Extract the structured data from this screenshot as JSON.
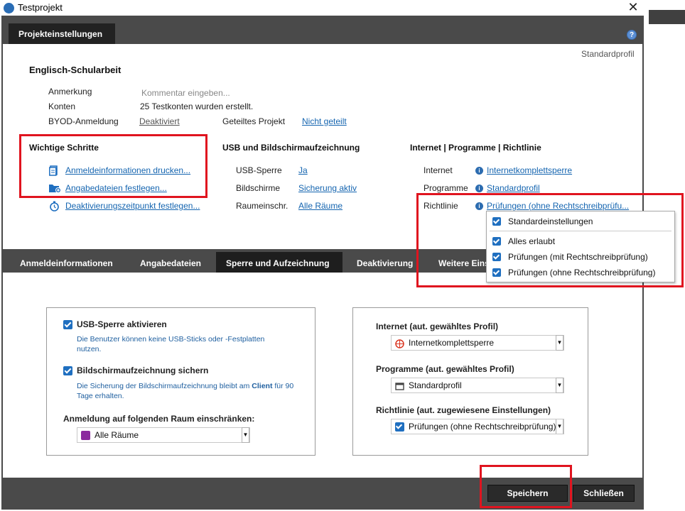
{
  "window": {
    "title": "Testprojekt",
    "close_glyph": "✕"
  },
  "header": {
    "tab_label": "Projekteinstellungen",
    "help_glyph": "?",
    "profile_label": "Standardprofil"
  },
  "project": {
    "name": "Englisch-Schularbeit"
  },
  "info": {
    "anmerkung_label": "Anmerkung",
    "anmerkung_placeholder": "Kommentar eingeben...",
    "konten_label": "Konten",
    "konten_value": "25 Testkonten wurden erstellt.",
    "byod_label": "BYOD-Anmeldung",
    "byod_value": "Deaktiviert",
    "shared_label": "Geteiltes Projekt",
    "shared_value": "Nicht geteilt"
  },
  "steps": {
    "title": "Wichtige Schritte",
    "items": [
      {
        "label": "Anmeldeinformationen drucken...",
        "icon": "document-icon"
      },
      {
        "label": "Angabedateien festlegen...",
        "icon": "folder-add-icon"
      },
      {
        "label": "Deaktivierungszeitpunkt festlegen...",
        "icon": "stopwatch-icon"
      }
    ]
  },
  "usb": {
    "title": "USB und Bildschirmaufzeichnung",
    "rows": [
      {
        "label": "USB-Sperre",
        "value": "Ja"
      },
      {
        "label": "Bildschirme",
        "value": "Sicherung aktiv"
      },
      {
        "label": "Raumeinschr.",
        "value": "Alle Räume"
      }
    ]
  },
  "internet": {
    "title": "Internet | Programme | Richtlinie",
    "rows": [
      {
        "label": "Internet",
        "value": "Internetkomplettsperre"
      },
      {
        "label": "Programme",
        "value": "Standardprofil"
      },
      {
        "label": "Richtlinie",
        "value": "Prüfungen (ohne Rechtschreibprüfu..."
      }
    ]
  },
  "policy_popup": {
    "items": [
      "Standardeinstellungen",
      "Alles erlaubt",
      "Prüfungen (mit Rechtschreibprüfung)",
      "Prüfungen (ohne Rechtschreibprüfung)"
    ]
  },
  "tabs": [
    "Anmeldeinformationen",
    "Angabedateien",
    "Sperre und Aufzeichnung",
    "Deaktivierung",
    "Weitere Eins"
  ],
  "left_panel": {
    "usb_lock_label": "USB-Sperre aktivieren",
    "usb_lock_desc": "Die Benutzer können keine USB-Sticks oder -Festplatten nutzen.",
    "screen_label": "Bildschirmaufzeichnung sichern",
    "screen_desc_1": "Die Sicherung der Bildschirmaufzeichnung bleibt am ",
    "screen_desc_bold": "Client",
    "screen_desc_2": " für 90 Tage erhalten.",
    "room_label": "Anmeldung auf folgenden Raum einschränken:",
    "room_value": "Alle Räume"
  },
  "right_panel": {
    "internet_label": "Internet (aut. gewähltes Profil)",
    "internet_value": "Internetkomplettsperre",
    "programs_label": "Programme (aut. gewähltes Profil)",
    "programs_value": "Standardprofil",
    "policy_label": "Richtlinie (aut. zugewiesene Einstellungen)",
    "policy_value": "Prüfungen (ohne Rechtschreibprüfung)"
  },
  "buttons": {
    "save": "Speichern",
    "close": "Schließen"
  },
  "colors": {
    "accent": "#1f6fc0",
    "highlight": "#e0141f",
    "dark": "#4a4a4a"
  }
}
